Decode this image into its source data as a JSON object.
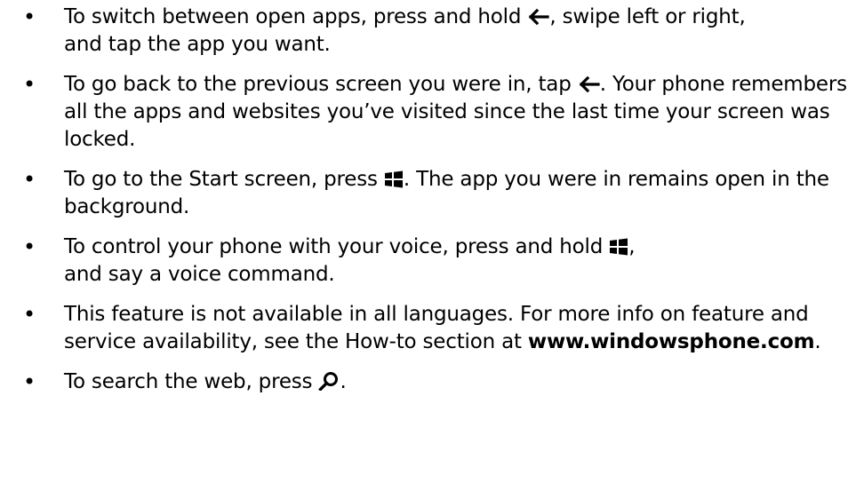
{
  "list": {
    "items": [
      {
        "part1": "To switch between open apps, press and hold ",
        "icon": "back-arrow-icon",
        "part2": ", swipe left or right,",
        "part3": "and tap the app you want."
      },
      {
        "part1": "To go back to the previous screen you were in, tap ",
        "icon": "back-arrow-icon",
        "part2": ". Your phone remembers all the apps and websites you’ve visited since the last time your screen was locked."
      },
      {
        "part1": "To go to the Start screen, press ",
        "icon": "windows-start-icon",
        "part2": ". The app you were in remains open in the background."
      },
      {
        "part1": "To control your phone with your voice, press and hold ",
        "icon": "windows-start-icon",
        "part2": ",",
        "part3": "and say a voice command."
      },
      {
        "part1": "This feature is not available in all languages. For more info on feature and service availability, see the How-to section at ",
        "link": "www.windowsphone.com",
        "part2": "."
      },
      {
        "part1": "To search the web, press ",
        "icon": "search-icon",
        "part2": "."
      }
    ]
  },
  "colors": {
    "text": "#000000",
    "background": "#ffffff"
  }
}
